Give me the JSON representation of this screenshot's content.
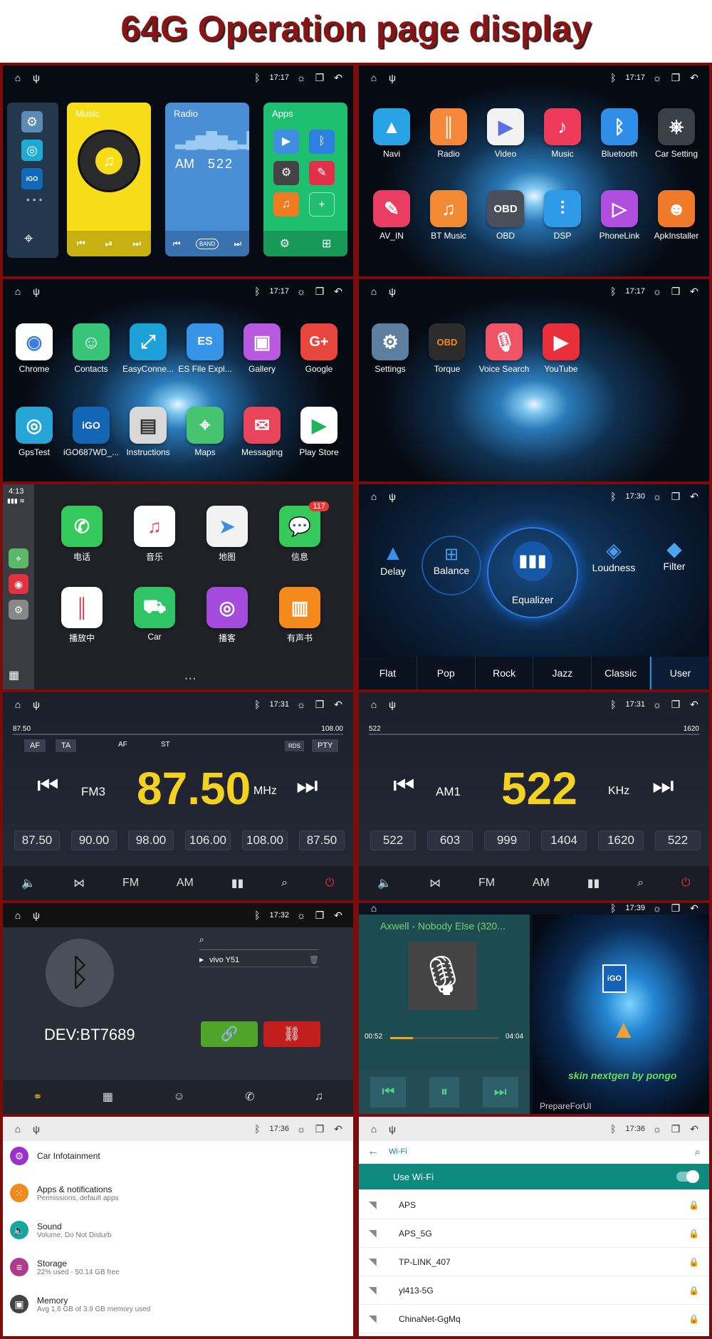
{
  "page_title": "64G  Operation page display",
  "status": {
    "time1": "17:17",
    "time2": "17:17",
    "time3": "17:17",
    "time4": "17:17",
    "time6": "17:30",
    "time7": "17:31",
    "time8": "17:31",
    "time9": "17:32",
    "time10": "17:39",
    "time11": "17:36",
    "time12": "17:36"
  },
  "p1": {
    "music": "Music",
    "radio": "Radio",
    "apps": "Apps",
    "radio_band": "AM",
    "radio_freq": "522"
  },
  "p2": {
    "apps": [
      "Navi",
      "Radio",
      "Video",
      "Music",
      "Bluetooth",
      "Car Setting",
      "AV_IN",
      "BT Music",
      "OBD",
      "DSP",
      "PhoneLink",
      "ApkInstaller"
    ]
  },
  "p3": {
    "apps": [
      "Chrome",
      "Contacts",
      "EasyConne...",
      "ES File Expl...",
      "Gallery",
      "Google",
      "GpsTest",
      "iGO687WD_...",
      "Instructions",
      "Maps",
      "Messaging",
      "Play Store"
    ]
  },
  "p4": {
    "apps": [
      "Settings",
      "Torque",
      "Voice Search",
      "YouTube"
    ]
  },
  "p5": {
    "time": "4:13",
    "badge": "117",
    "apps": [
      "电话",
      "音乐",
      "地图",
      "信息",
      "播放中",
      "Car",
      "播客",
      "有声书"
    ]
  },
  "p6": {
    "effects": [
      "Delay",
      "Balance",
      "Equalizer",
      "Loudness",
      "Filter"
    ],
    "presets": [
      "Flat",
      "Pop",
      "Rock",
      "Jazz",
      "Classic",
      "User"
    ]
  },
  "p7": {
    "min": "87.50",
    "max": "108.00",
    "af": "AF",
    "ta": "TA",
    "af2": "AF",
    "st": "ST",
    "pty": "PTY",
    "rds": "RDS",
    "band": "FM3",
    "freq": "87.50",
    "unit": "MHz",
    "presets": [
      "87.50",
      "90.00",
      "98.00",
      "106.00",
      "108.00",
      "87.50"
    ],
    "fm": "FM",
    "am": "AM"
  },
  "p8": {
    "min": "522",
    "max": "1620",
    "band": "AM1",
    "freq": "522",
    "unit": "KHz",
    "presets": [
      "522",
      "603",
      "999",
      "1404",
      "1620",
      "522"
    ],
    "fm": "FM",
    "am": "AM"
  },
  "p9": {
    "device": "vivo Y51",
    "name": "DEV:BT7689"
  },
  "p10": {
    "song": "Axwell - Nobody Else (320...",
    "elapsed": "00:52",
    "total": "04:04",
    "progress": 0.21,
    "skin": "skin nextgen by pongo",
    "prepare": "PrepareForUI",
    "igo": "iGO"
  },
  "p11": {
    "items": [
      {
        "title": "Car Infotainment",
        "sub": "",
        "color": "#9b30d0"
      },
      {
        "title": "Apps & notifications",
        "sub": "Permissions, default apps",
        "color": "#f08a1c"
      },
      {
        "title": "Sound",
        "sub": "Volume, Do Not Disturb",
        "color": "#12a8a0"
      },
      {
        "title": "Storage",
        "sub": "22% used - 50.14 GB free",
        "color": "#b03a8c"
      },
      {
        "title": "Memory",
        "sub": "Avg 1.6 GB of 3.9 GB memory used",
        "color": "#444444"
      }
    ]
  },
  "p12": {
    "header": "Wi-Fi",
    "use": "Use Wi-Fi",
    "networks": [
      "APS",
      "APS_5G",
      "TP-LINK_407",
      "yl413-5G",
      "ChinaNet-GgMq"
    ]
  }
}
